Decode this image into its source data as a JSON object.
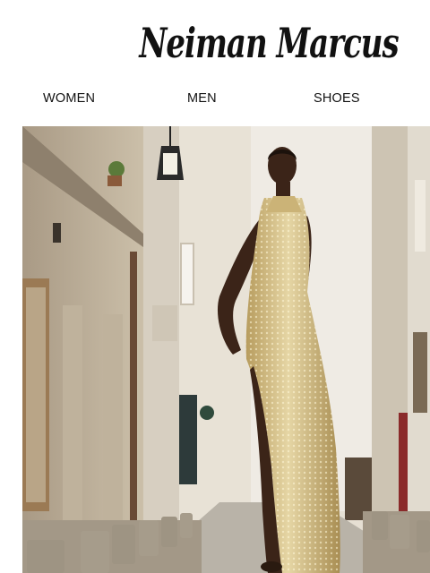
{
  "brand": {
    "logo_text": "Neiman Marcus"
  },
  "nav": {
    "items": [
      "WOMEN",
      "MEN",
      "SHOES"
    ]
  },
  "hero": {
    "alt": "Model in a gold sequined halter gown standing on a narrow Parisian street"
  },
  "colors": {
    "background": "#ffffff",
    "text": "#111111",
    "gown": "#d8c28c",
    "stone": "#cfc2ad"
  }
}
